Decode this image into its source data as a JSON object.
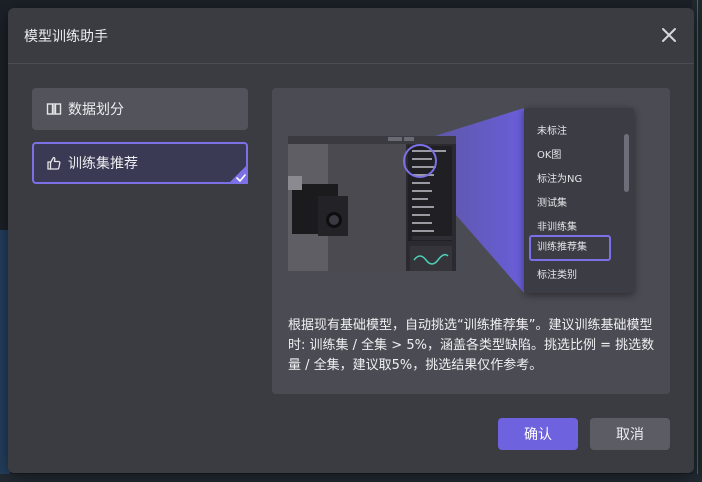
{
  "dialog": {
    "title": "模型训练助手"
  },
  "menu": [
    {
      "label": "数据划分",
      "icon": "split-icon",
      "active": false
    },
    {
      "label": "训练集推荐",
      "icon": "thumbs-up-icon",
      "active": true
    }
  ],
  "popup": {
    "items": [
      "未标注",
      "OK图",
      "标注为NG",
      "测试集",
      "非训练集",
      "训练推荐集",
      "标注类别"
    ],
    "selected": "训练推荐集"
  },
  "description": "根据现有基础模型，自动挑选“训练推荐集”。建议训练基础模型时: 训练集 / 全集 > 5%，涵盖各类型缺陷。挑选比例 = 挑选数量 / 全集，建议取5%，挑选结果仅作参考。",
  "buttons": {
    "confirm": "确认",
    "cancel": "取消"
  },
  "colors": {
    "accent": "#6f62df",
    "dialog_bg": "#3b3b42"
  }
}
